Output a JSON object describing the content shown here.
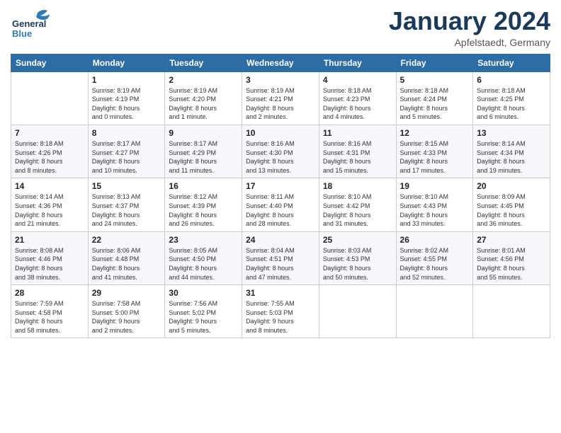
{
  "logo": {
    "line1": "General",
    "line2": "Blue"
  },
  "title": "January 2024",
  "location": "Apfelstaedt, Germany",
  "header": {
    "days": [
      "Sunday",
      "Monday",
      "Tuesday",
      "Wednesday",
      "Thursday",
      "Friday",
      "Saturday"
    ]
  },
  "weeks": [
    [
      {
        "day": "",
        "info": ""
      },
      {
        "day": "1",
        "info": "Sunrise: 8:19 AM\nSunset: 4:19 PM\nDaylight: 8 hours\nand 0 minutes."
      },
      {
        "day": "2",
        "info": "Sunrise: 8:19 AM\nSunset: 4:20 PM\nDaylight: 8 hours\nand 1 minute."
      },
      {
        "day": "3",
        "info": "Sunrise: 8:19 AM\nSunset: 4:21 PM\nDaylight: 8 hours\nand 2 minutes."
      },
      {
        "day": "4",
        "info": "Sunrise: 8:18 AM\nSunset: 4:23 PM\nDaylight: 8 hours\nand 4 minutes."
      },
      {
        "day": "5",
        "info": "Sunrise: 8:18 AM\nSunset: 4:24 PM\nDaylight: 8 hours\nand 5 minutes."
      },
      {
        "day": "6",
        "info": "Sunrise: 8:18 AM\nSunset: 4:25 PM\nDaylight: 8 hours\nand 6 minutes."
      }
    ],
    [
      {
        "day": "7",
        "info": "Sunrise: 8:18 AM\nSunset: 4:26 PM\nDaylight: 8 hours\nand 8 minutes."
      },
      {
        "day": "8",
        "info": "Sunrise: 8:17 AM\nSunset: 4:27 PM\nDaylight: 8 hours\nand 10 minutes."
      },
      {
        "day": "9",
        "info": "Sunrise: 8:17 AM\nSunset: 4:29 PM\nDaylight: 8 hours\nand 11 minutes."
      },
      {
        "day": "10",
        "info": "Sunrise: 8:16 AM\nSunset: 4:30 PM\nDaylight: 8 hours\nand 13 minutes."
      },
      {
        "day": "11",
        "info": "Sunrise: 8:16 AM\nSunset: 4:31 PM\nDaylight: 8 hours\nand 15 minutes."
      },
      {
        "day": "12",
        "info": "Sunrise: 8:15 AM\nSunset: 4:33 PM\nDaylight: 8 hours\nand 17 minutes."
      },
      {
        "day": "13",
        "info": "Sunrise: 8:14 AM\nSunset: 4:34 PM\nDaylight: 8 hours\nand 19 minutes."
      }
    ],
    [
      {
        "day": "14",
        "info": "Sunrise: 8:14 AM\nSunset: 4:36 PM\nDaylight: 8 hours\nand 21 minutes."
      },
      {
        "day": "15",
        "info": "Sunrise: 8:13 AM\nSunset: 4:37 PM\nDaylight: 8 hours\nand 24 minutes."
      },
      {
        "day": "16",
        "info": "Sunrise: 8:12 AM\nSunset: 4:39 PM\nDaylight: 8 hours\nand 26 minutes."
      },
      {
        "day": "17",
        "info": "Sunrise: 8:11 AM\nSunset: 4:40 PM\nDaylight: 8 hours\nand 28 minutes."
      },
      {
        "day": "18",
        "info": "Sunrise: 8:10 AM\nSunset: 4:42 PM\nDaylight: 8 hours\nand 31 minutes."
      },
      {
        "day": "19",
        "info": "Sunrise: 8:10 AM\nSunset: 4:43 PM\nDaylight: 8 hours\nand 33 minutes."
      },
      {
        "day": "20",
        "info": "Sunrise: 8:09 AM\nSunset: 4:45 PM\nDaylight: 8 hours\nand 36 minutes."
      }
    ],
    [
      {
        "day": "21",
        "info": "Sunrise: 8:08 AM\nSunset: 4:46 PM\nDaylight: 8 hours\nand 38 minutes."
      },
      {
        "day": "22",
        "info": "Sunrise: 8:06 AM\nSunset: 4:48 PM\nDaylight: 8 hours\nand 41 minutes."
      },
      {
        "day": "23",
        "info": "Sunrise: 8:05 AM\nSunset: 4:50 PM\nDaylight: 8 hours\nand 44 minutes."
      },
      {
        "day": "24",
        "info": "Sunrise: 8:04 AM\nSunset: 4:51 PM\nDaylight: 8 hours\nand 47 minutes."
      },
      {
        "day": "25",
        "info": "Sunrise: 8:03 AM\nSunset: 4:53 PM\nDaylight: 8 hours\nand 50 minutes."
      },
      {
        "day": "26",
        "info": "Sunrise: 8:02 AM\nSunset: 4:55 PM\nDaylight: 8 hours\nand 52 minutes."
      },
      {
        "day": "27",
        "info": "Sunrise: 8:01 AM\nSunset: 4:56 PM\nDaylight: 8 hours\nand 55 minutes."
      }
    ],
    [
      {
        "day": "28",
        "info": "Sunrise: 7:59 AM\nSunset: 4:58 PM\nDaylight: 8 hours\nand 58 minutes."
      },
      {
        "day": "29",
        "info": "Sunrise: 7:58 AM\nSunset: 5:00 PM\nDaylight: 9 hours\nand 2 minutes."
      },
      {
        "day": "30",
        "info": "Sunrise: 7:56 AM\nSunset: 5:02 PM\nDaylight: 9 hours\nand 5 minutes."
      },
      {
        "day": "31",
        "info": "Sunrise: 7:55 AM\nSunset: 5:03 PM\nDaylight: 9 hours\nand 8 minutes."
      },
      {
        "day": "",
        "info": ""
      },
      {
        "day": "",
        "info": ""
      },
      {
        "day": "",
        "info": ""
      }
    ]
  ]
}
